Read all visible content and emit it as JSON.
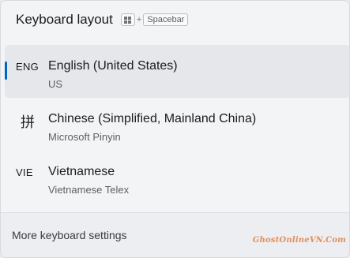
{
  "header": {
    "title": "Keyboard layout",
    "shortcut": {
      "win_key_icon": "windows-logo-icon",
      "plus": "+",
      "spacebar": "Spacebar"
    }
  },
  "layouts": [
    {
      "code": "ENG",
      "name": "English (United States)",
      "keyboard": "US",
      "selected": true
    },
    {
      "code": "拼",
      "name": "Chinese (Simplified, Mainland China)",
      "keyboard": "Microsoft Pinyin",
      "selected": false
    },
    {
      "code": "VIE",
      "name": "Vietnamese",
      "keyboard": "Vietnamese Telex",
      "selected": false
    }
  ],
  "footer": {
    "more_settings": "More keyboard settings"
  },
  "watermark": "GhostOnlineVN.Com",
  "colors": {
    "accent": "#0067c0",
    "background": "#f3f4f6",
    "selected_row": "#e5e7ea"
  }
}
